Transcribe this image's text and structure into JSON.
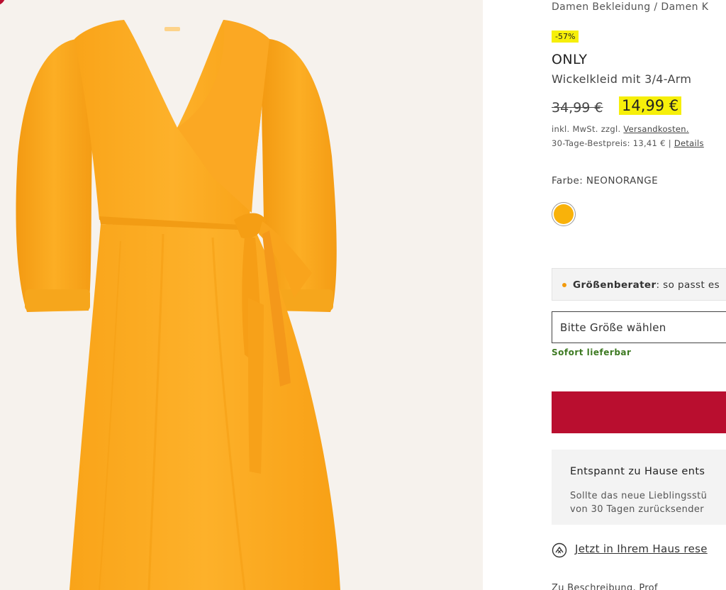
{
  "breadcrumb": "Damen Bekleidung / Damen K",
  "product": {
    "discount_badge": "-57%",
    "brand": "ONLY",
    "name": "Wickelkleid mit 3/4-Arm",
    "old_price": "34,99 €",
    "new_price": "14,99 €",
    "tax_prefix": "inkl. MwSt. zzgl. ",
    "tax_link": "Versandkosten.",
    "best_price_prefix": "30-Tage-Bestpreis: 13,41 € | ",
    "best_price_link": "Details"
  },
  "color": {
    "label": "Farbe: NEONORANGE",
    "swatch_color": "#f9b20a"
  },
  "size_advisor": {
    "bold": "Größenberater",
    "text": ": so passt es"
  },
  "size_select": {
    "placeholder": "Bitte Größe wählen"
  },
  "availability": "Sofort lieferbar",
  "info_box": {
    "title": "Entspannt zu Hause ents",
    "line1": "Sollte das neue Lieblingsstü",
    "line2": "von 30 Tagen zurücksender"
  },
  "reserve_link": "Jetzt in Ihrem Haus rese",
  "bottom_cut_text": "Zu Beschreibung, Prof",
  "colors": {
    "accent": "#b90e2f",
    "highlight": "#f6ef0a",
    "availability": "#3d7a22",
    "dress": "#fbaa1c"
  },
  "icons": [
    "reserve-store-icon"
  ]
}
